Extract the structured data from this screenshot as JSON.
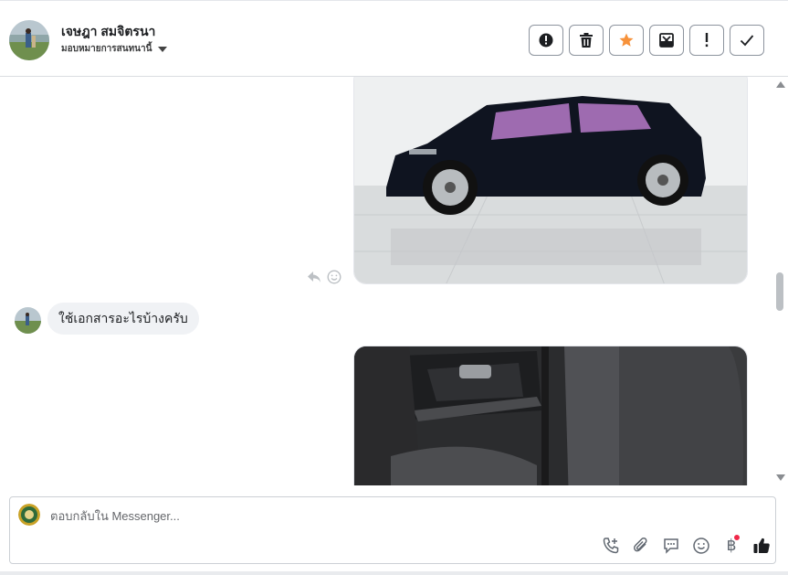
{
  "header": {
    "contact_name": "เจษฎา สมจิตรนา",
    "assign_label": "มอบหมายการสนทนานี้",
    "actions": [
      {
        "name": "spam-button",
        "icon": "alert-circle-icon"
      },
      {
        "name": "delete-button",
        "icon": "trash-icon"
      },
      {
        "name": "star-button",
        "icon": "star-icon"
      },
      {
        "name": "mark-unread-button",
        "icon": "envelope-x-icon"
      },
      {
        "name": "follow-up-button",
        "icon": "exclamation-icon"
      },
      {
        "name": "mark-done-button",
        "icon": "check-icon"
      }
    ]
  },
  "conversation": {
    "messages": [
      {
        "type": "image",
        "direction": "outgoing",
        "description_icon": "car-photo"
      },
      {
        "type": "text",
        "direction": "incoming",
        "text": "ใช้เอกสารอะไรบ้างครับ"
      },
      {
        "type": "image",
        "direction": "outgoing",
        "description_icon": "car-interior-photo"
      }
    ]
  },
  "composer": {
    "placeholder": "ตอบกลับใน Messenger..."
  },
  "colors": {
    "accent_star": "#f7923a",
    "notification_dot": "#f02849",
    "bubble_bg": "#f0f2f5"
  }
}
